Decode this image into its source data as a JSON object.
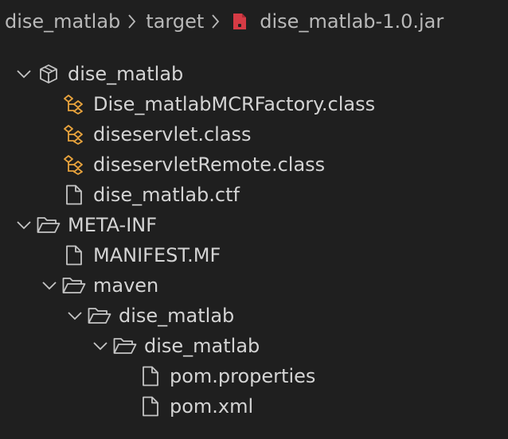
{
  "breadcrumb": {
    "parts": [
      "dise_matlab",
      "target",
      "dise_matlab-1.0.jar"
    ]
  },
  "tree": {
    "items": [
      {
        "label": "dise_matlab",
        "depth": 0,
        "kind": "package",
        "expanded": true
      },
      {
        "label": "Dise_matlabMCRFactory.class",
        "depth": 1,
        "kind": "class"
      },
      {
        "label": "diseservlet.class",
        "depth": 1,
        "kind": "class"
      },
      {
        "label": "diseservletRemote.class",
        "depth": 1,
        "kind": "class"
      },
      {
        "label": "dise_matlab.ctf",
        "depth": 1,
        "kind": "file"
      },
      {
        "label": "META-INF",
        "depth": 0,
        "kind": "folder",
        "expanded": true
      },
      {
        "label": "MANIFEST.MF",
        "depth": 1,
        "kind": "file"
      },
      {
        "label": "maven",
        "depth": 1,
        "kind": "folder",
        "expanded": true
      },
      {
        "label": "dise_matlab",
        "depth": 2,
        "kind": "folder",
        "expanded": true
      },
      {
        "label": "dise_matlab",
        "depth": 3,
        "kind": "folder",
        "expanded": true
      },
      {
        "label": "pom.properties",
        "depth": 4,
        "kind": "file"
      },
      {
        "label": "pom.xml",
        "depth": 4,
        "kind": "file"
      }
    ]
  },
  "colors": {
    "background": "#1f1f1f",
    "text": "#d4d4d4",
    "breadcrumb_text": "#b9b9b9",
    "icon_gray": "#c5c5c5",
    "class_icon": "#e8a33d",
    "jar_icon": "#d63b45"
  }
}
